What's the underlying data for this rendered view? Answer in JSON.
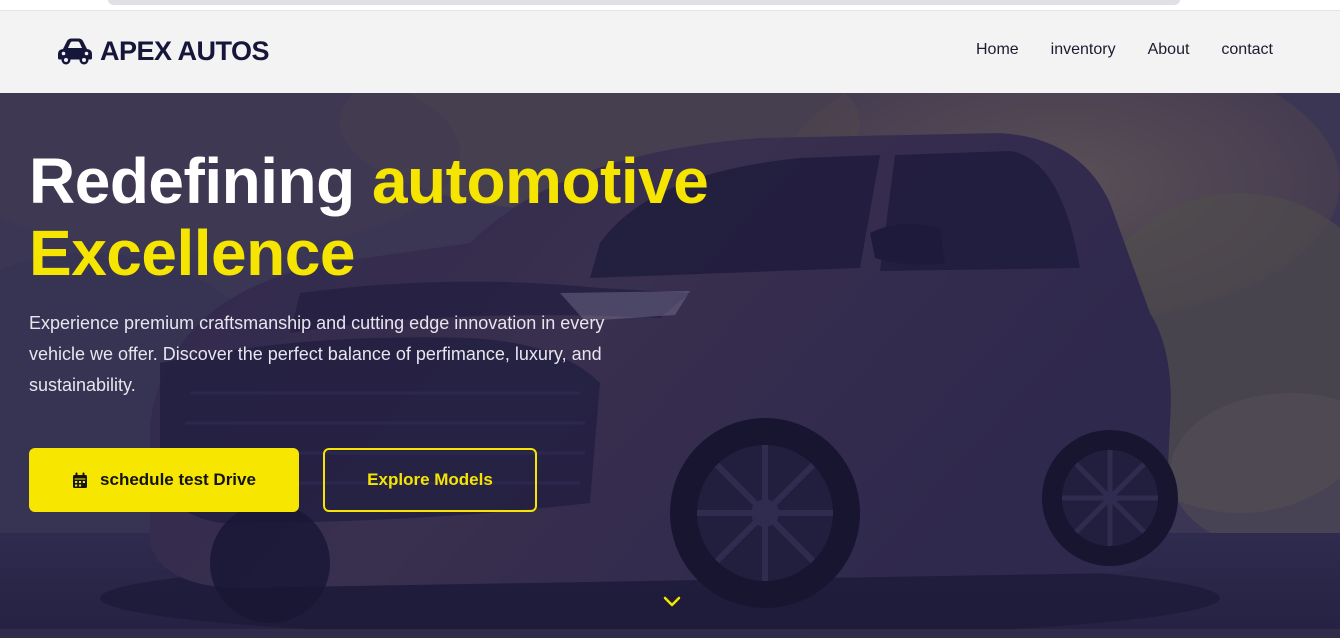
{
  "brand": {
    "name": "APEX AUTOS",
    "icon": "car-icon",
    "color": "#16163a"
  },
  "nav": {
    "items": [
      {
        "label": "Home"
      },
      {
        "label": "inventory"
      },
      {
        "label": "About"
      },
      {
        "label": "contact"
      }
    ]
  },
  "hero": {
    "headline_part1": "Redefining ",
    "headline_part2": "automotive",
    "headline_part3": "Excellence",
    "description": "Experience premium craftsmanship and cutting edge innovation in every vehicle we offer. Discover the perfect balance of perfimance, luxury, and sustainability.",
    "primary_button": {
      "label": "schedule test Drive",
      "icon": "calendar-icon"
    },
    "secondary_button": {
      "label": "Explore Models"
    },
    "scroll_indicator_icon": "chevron-down-icon"
  },
  "colors": {
    "accent": "#f5e500",
    "navbar_bg": "#f3f3f4",
    "text_dark": "#16163a"
  }
}
